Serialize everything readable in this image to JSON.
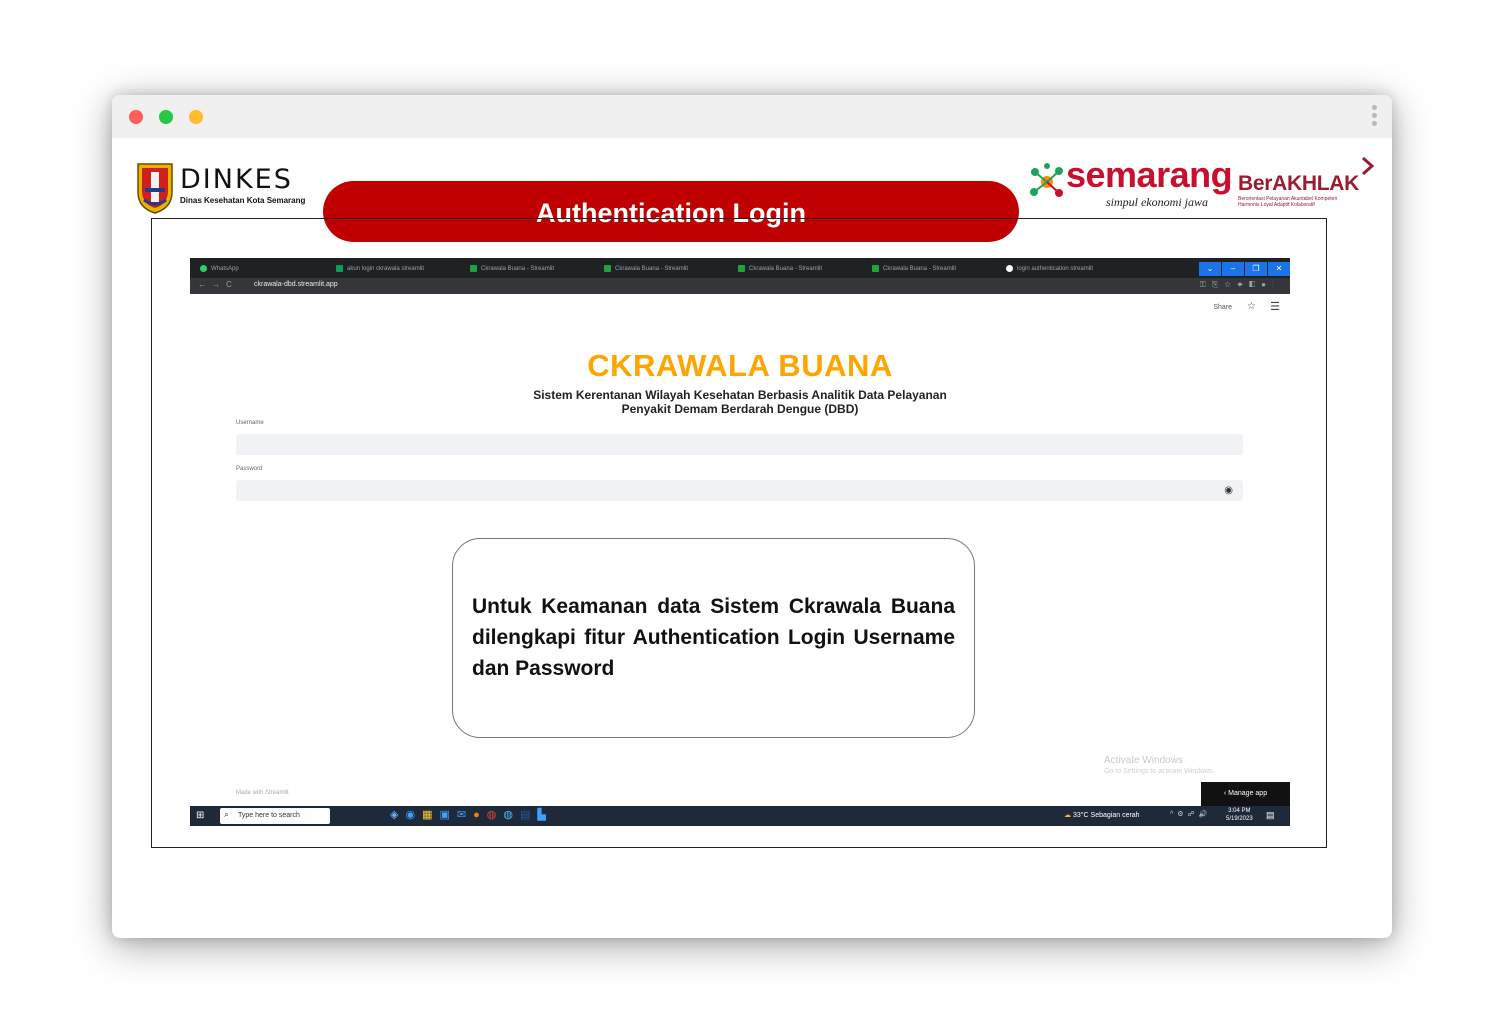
{
  "window": {
    "controls": [
      "close",
      "minimize",
      "maximize"
    ],
    "colors": {
      "close": "#ff5f57",
      "minimize": "#febc2e",
      "maximize": "#fdbd2c"
    }
  },
  "slide": {
    "title": "Authentication Login",
    "title_color": "#c00000",
    "logos": {
      "dinkes": {
        "name": "DINKES",
        "subtitle": "Dinas Kesehatan Kota Semarang"
      },
      "semarang": {
        "name": "semarang",
        "tagline": "simpul ekonomi jawa"
      },
      "berakhlak": {
        "name": "BerAKHLAK",
        "tagline_lines": [
          "Berorientasi Pelayanan Akuntabel Kompeten",
          "Harmonis Loyal Adaptif Kolaboratif"
        ]
      }
    },
    "note": "Untuk Keamanan data Sistem Ckrawala Buana dilengkapi fitur Authentication Login Username dan Password"
  },
  "browser": {
    "tabs": [
      {
        "label": "WhatsApp",
        "icon": "whatsapp-icon",
        "color": "#25d366"
      },
      {
        "label": "akun login ckrawala streamlit",
        "icon": "sheets-icon",
        "color": "#0f9d58"
      },
      {
        "label": "Ckrawala Buana - Streamlit",
        "icon": "check-icon",
        "color": "#1fa33a"
      },
      {
        "label": "Ckrawala Buana - Streamlit",
        "icon": "check-icon",
        "color": "#1fa33a"
      },
      {
        "label": "Ckrawala Buana - Streamlit",
        "icon": "check-icon",
        "color": "#1fa33a"
      },
      {
        "label": "Ckrawala Buana - Streamlit",
        "icon": "check-icon",
        "color": "#1fa33a"
      },
      {
        "label": "login authentication streamlit",
        "icon": "google-icon",
        "color": "#ffffff"
      }
    ],
    "url": "ckrawala-dbd.streamlit.app"
  },
  "app": {
    "share_label": "Share",
    "title": "CKRAWALA BUANA",
    "subtitle_line1": "Sistem Kerentanan Wilayah Kesehatan Berbasis Analitik Data Pelayanan",
    "subtitle_line2": "Penyakit Demam Berdarah Dengue (DBD)",
    "username_label": "Username",
    "password_label": "Password",
    "footer": "Made with Streamlit",
    "manage_app": "Manage app",
    "activate_title": "Activate Windows",
    "activate_sub": "Go to Settings to activate Windows."
  },
  "taskbar": {
    "search_placeholder": "Type here to search",
    "weather": "33°C  Sebagian cerah",
    "time": "3:04 PM",
    "date": "5/19/2023"
  }
}
